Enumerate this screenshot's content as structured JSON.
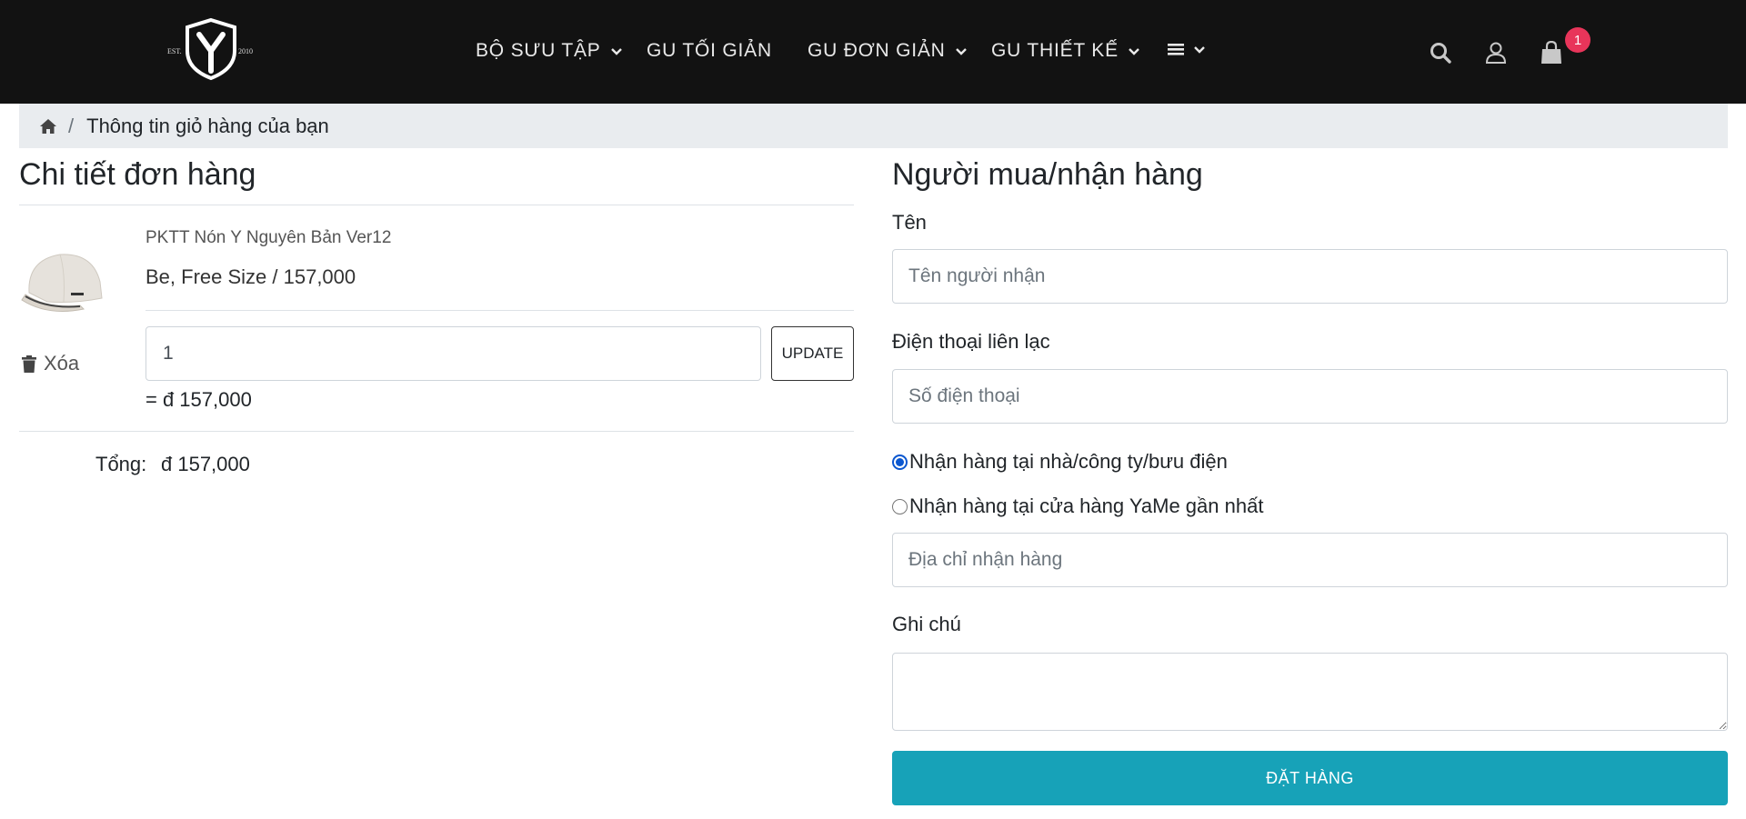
{
  "header": {
    "logo": {
      "icon": "shield-y-logo-icon",
      "est_text": "EST.",
      "year_text": "2010"
    },
    "nav": [
      {
        "label": "BỘ SƯU TẬP",
        "has_dropdown": true
      },
      {
        "label": "GU TỐI GIẢN",
        "has_dropdown": false
      },
      {
        "label": "GU ĐƠN GIẢN",
        "has_dropdown": true
      },
      {
        "label": "GU THIẾT KẾ",
        "has_dropdown": true
      },
      {
        "icon": "hamburger-icon",
        "has_dropdown": true
      }
    ],
    "icons": [
      "search-icon",
      "user-icon",
      "shopping-bag-icon"
    ],
    "cart_count": "1"
  },
  "breadcrumb": {
    "home_icon": "home-icon",
    "separator": "/",
    "current": "Thông tin giỏ hàng của bạn"
  },
  "order": {
    "title": "Chi tiết đơn hàng",
    "item": {
      "image_icon": "baseball-cap-image",
      "name": "PKTT Nón Y Nguyên Bản Ver12",
      "variant": "Be, Free Size / 157,000",
      "quantity": "1",
      "update_label": "UPDATE",
      "delete_label": "Xóa",
      "line_total": "= đ 157,000"
    },
    "total_label": "Tổng:",
    "total_value": "đ 157,000"
  },
  "buyer": {
    "title": "Người mua/nhận hàng",
    "name_label": "Tên",
    "name_placeholder": "Tên người nhận",
    "phone_label": "Điện thoại liên lạc",
    "phone_placeholder": "Số điện thoại",
    "delivery_options": [
      {
        "label": "Nhận hàng tại nhà/công ty/bưu điện",
        "checked": true
      },
      {
        "label": "Nhận hàng tại cửa hàng YaMe gần nhất",
        "checked": false
      }
    ],
    "address_placeholder": "Địa chỉ nhận hàng",
    "note_label": "Ghi chú",
    "submit_label": "ĐẶT HÀNG"
  },
  "colors": {
    "header_bg": "#121212",
    "badge": "#e8355a",
    "primary_button": "#17a2b8",
    "breadcrumb_bg": "#e9ecef"
  }
}
